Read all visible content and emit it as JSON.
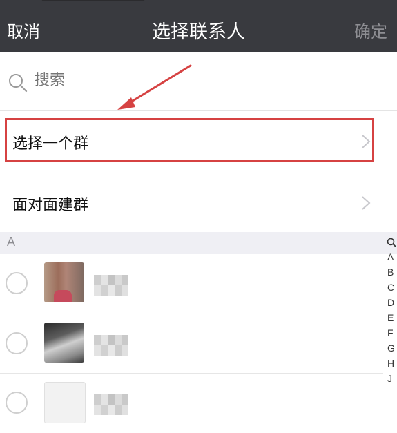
{
  "nav": {
    "cancel_label": "取消",
    "title": "选择联系人",
    "confirm_label": "确定"
  },
  "search": {
    "placeholder": "搜索",
    "icon": "search-icon"
  },
  "menu": {
    "select_group_label": "选择一个群",
    "face_to_face_label": "面对面建群"
  },
  "section": {
    "letter": "A"
  },
  "index_bar": {
    "letters": [
      "A",
      "B",
      "C",
      "D",
      "E",
      "F",
      "G",
      "H",
      "J"
    ]
  },
  "colors": {
    "nav_background": "#393a3f",
    "highlight_red": "#d64242",
    "section_background": "#efeff4"
  }
}
